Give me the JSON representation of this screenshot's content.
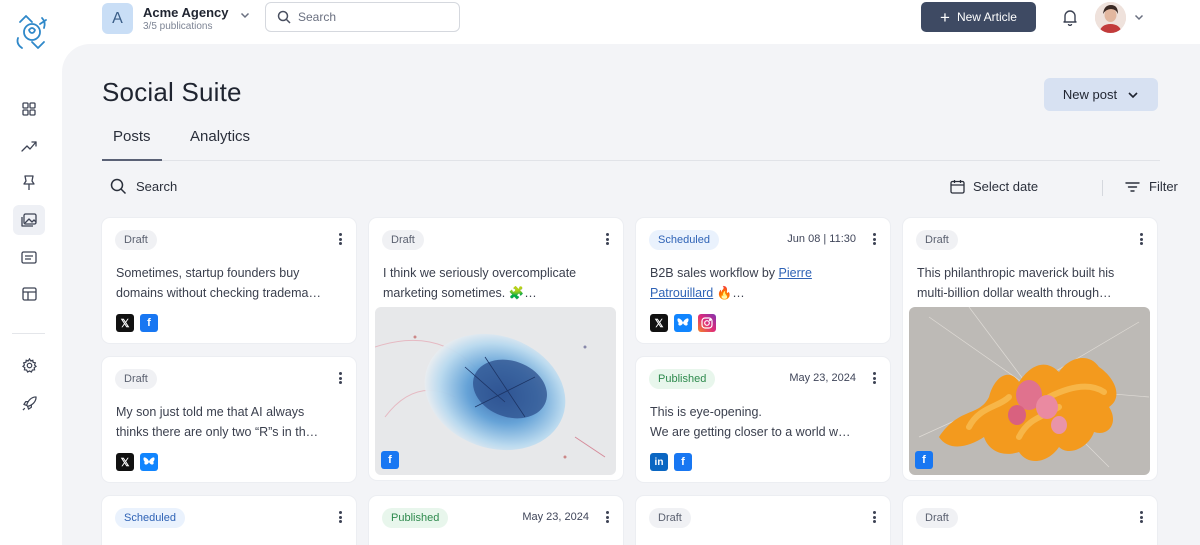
{
  "topbar": {
    "org_initial": "A",
    "org_name": "Acme Agency",
    "org_sub": "3/5 publications",
    "search_placeholder": "Search",
    "new_article_label": "New Article"
  },
  "sidebar": {
    "items": [
      {
        "icon": "grid-icon"
      },
      {
        "icon": "trending-icon"
      },
      {
        "icon": "pin-icon"
      },
      {
        "icon": "image-gallery-icon",
        "active": true
      },
      {
        "icon": "newspaper-icon"
      },
      {
        "icon": "layout-icon"
      },
      {
        "icon": "settings-icon"
      },
      {
        "icon": "rocket-icon"
      }
    ]
  },
  "page": {
    "title": "Social Suite",
    "new_post_label": "New post",
    "tabs": [
      {
        "label": "Posts",
        "active": true
      },
      {
        "label": "Analytics",
        "active": false
      }
    ],
    "search_label": "Search",
    "select_date_label": "Select date",
    "filter_label": "Filter"
  },
  "cards": [
    {
      "status": "Draft",
      "date": "",
      "lines": [
        "Sometimes, startup founders buy",
        "domains without checking tradema…"
      ],
      "socials": [
        "x",
        "facebook"
      ]
    },
    {
      "status": "Draft",
      "date": "",
      "lines": [
        "My son just told me that AI always",
        "thinks there are only two “R”s in th…"
      ],
      "socials": [
        "x",
        "bluesky"
      ]
    },
    {
      "status": "Scheduled",
      "date": "",
      "lines": [],
      "socials": []
    },
    {
      "status": "Draft",
      "date": "",
      "lines": [
        "I think we seriously overcomplicate",
        "marketing sometimes. 🧩…"
      ],
      "socials": [
        "facebook"
      ],
      "image": "blue-abstract-shape"
    },
    {
      "status": "Published",
      "date": "May 23, 2024",
      "lines": [],
      "socials": []
    },
    {
      "status": "Scheduled",
      "date": "Jun 08 | 11:30",
      "line1_prefix": "B2B sales workflow by",
      "line1_link": "Pierre",
      "line2_link": "Patrouillard",
      "line2_suffix": "🔥…",
      "socials": [
        "x",
        "bluesky",
        "instagram"
      ]
    },
    {
      "status": "Published",
      "date": "May 23, 2024",
      "lines": [
        "This is eye-opening.",
        "We are getting closer to a world w…"
      ],
      "socials": [
        "linkedin",
        "facebook"
      ]
    },
    {
      "status": "Draft",
      "date": "",
      "lines": [],
      "socials": []
    },
    {
      "status": "Draft",
      "date": "",
      "lines": [
        "This philanthropic maverick built his",
        "multi-billion dollar wealth through…"
      ],
      "socials": [
        "facebook"
      ],
      "image": "orange-coral-sculpture"
    },
    {
      "status": "Draft",
      "date": "",
      "lines": [],
      "socials": []
    }
  ],
  "colors": {
    "accent_dark": "#3e4a63",
    "new_post_bg": "#d7e1f2",
    "main_bg": "#f3f4f7",
    "scheduled": "#2f63b6",
    "published": "#2e8a4d"
  }
}
